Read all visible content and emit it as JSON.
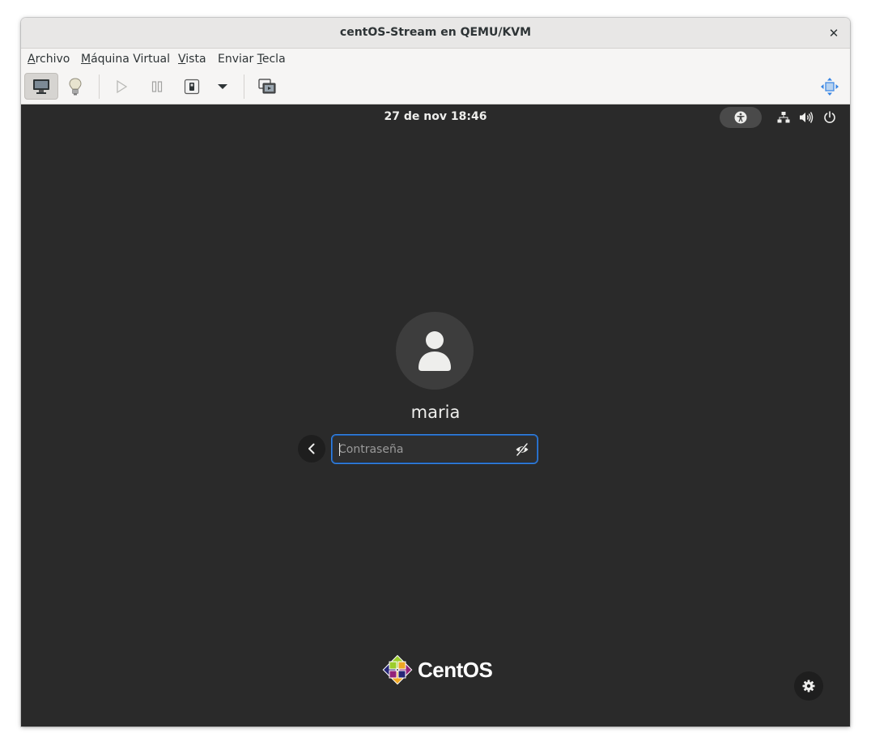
{
  "window": {
    "title": "centOS-Stream en QEMU/KVM",
    "close_glyph": "✕"
  },
  "menubar": [
    {
      "pre": "",
      "mn": "A",
      "post": "rchivo"
    },
    {
      "pre": "",
      "mn": "M",
      "post": "áquina Virtual"
    },
    {
      "pre": "",
      "mn": "V",
      "post": "ista"
    },
    {
      "pre": "Enviar ",
      "mn": "T",
      "post": "ecla"
    }
  ],
  "toolbar": {
    "icons": [
      "monitor-icon",
      "lightbulb-icon",
      "play-icon",
      "pause-icon",
      "power-switch-icon",
      "dropdown-arrow-icon",
      "screenshot-icon",
      "fullscreen-icon"
    ],
    "active": "monitor-icon"
  },
  "guest": {
    "clock": "27 de nov  18:46",
    "status_icons": [
      "accessibility-icon",
      "network-icon",
      "volume-icon",
      "power-icon"
    ],
    "login": {
      "username": "maria",
      "password_placeholder": "Contraseña",
      "password_value": ""
    },
    "logo_text": "CentOS",
    "colors": {
      "background": "#2a2a2a",
      "focus_ring": "#3584e4",
      "text": "#eeeeec"
    }
  }
}
